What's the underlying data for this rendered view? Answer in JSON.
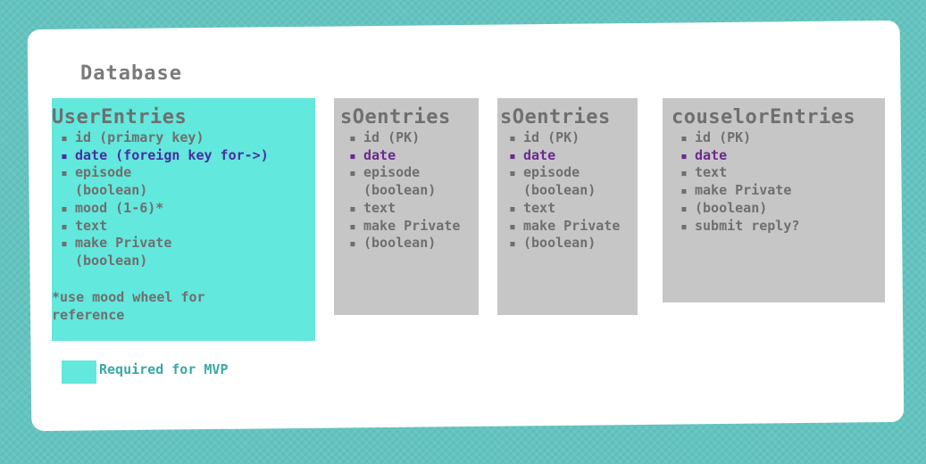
{
  "title": "Database",
  "tables": [
    {
      "name": "UserEntries",
      "fields": [
        {
          "text": "id (primary key)"
        },
        {
          "text": "date (foreign key for->)",
          "accent": true
        },
        {
          "text": "episode"
        },
        {
          "text": "(boolean)",
          "continuation": true
        },
        {
          "text": "mood (1-6)*"
        },
        {
          "text": "text"
        },
        {
          "text": "make Private"
        },
        {
          "text": "(boolean)",
          "continuation": true
        }
      ],
      "note": [
        "*use mood wheel for",
        "reference"
      ]
    },
    {
      "name": "sOentries",
      "fields": [
        {
          "text": "id (PK)"
        },
        {
          "text": "date",
          "accent": true
        },
        {
          "text": "episode"
        },
        {
          "text": "(boolean)",
          "continuation": true
        },
        {
          "text": "text"
        },
        {
          "text": "make Private"
        },
        {
          "text": "(boolean)"
        }
      ]
    },
    {
      "name": "sOentries",
      "fields": [
        {
          "text": "id (PK)"
        },
        {
          "text": "date",
          "accent": true
        },
        {
          "text": "episode"
        },
        {
          "text": "(boolean)",
          "continuation": true
        },
        {
          "text": "text"
        },
        {
          "text": "make Private"
        },
        {
          "text": "(boolean)"
        }
      ]
    },
    {
      "name": "couselorEntries",
      "fields": [
        {
          "text": "id (PK)"
        },
        {
          "text": "date",
          "accent": true
        },
        {
          "text": "text"
        },
        {
          "text": "make Private"
        },
        {
          "text": "(boolean)"
        },
        {
          "text": "submit reply?"
        }
      ]
    }
  ],
  "legend": {
    "label": "Required for MVP",
    "color": "#62e8dc"
  },
  "colors": {
    "teal_box": "#62e8dc",
    "grey_box": "#c6c6c6",
    "accent_purple": "#6b2a8f",
    "accent_indigo": "#4a2ea0",
    "text_grey": "#6f6f6f"
  }
}
